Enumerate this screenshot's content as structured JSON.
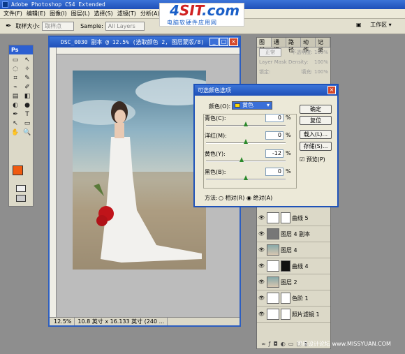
{
  "app": {
    "title": "Adobe Photoshop CS4 Extended"
  },
  "menu": [
    "文件(F)",
    "编辑(E)",
    "图像(I)",
    "图层(L)",
    "选择(S)",
    "滤镜(T)",
    "分析(A)",
    "视"
  ],
  "options": {
    "sample_size_label": "取样大小:",
    "sample_size_value": "取样点",
    "sample_label": "Sample:",
    "sample_value": "All Layers",
    "workspace": "工作区 ▾"
  },
  "logo": {
    "big_a": "4",
    "big_b": "SIT",
    "big_c": ".com",
    "small": "电脑软硬件应用网"
  },
  "toolbox": {
    "header": "Ps",
    "tools": [
      "▭",
      "↖",
      "◌",
      "✧",
      "⌗",
      "✎",
      "⌁",
      "✐",
      "▤",
      "◧",
      "◐",
      "●",
      "✒",
      "T",
      "↖",
      "▭",
      "✋",
      "🔍"
    ]
  },
  "document": {
    "title": "DSC_0030 副本 @ 12.5% (选取颜色 2, 图层蒙版/8)",
    "zoom": "12.5%",
    "size": "10.8 英寸 x 16.133 英寸 (240 ..."
  },
  "panel": {
    "tabs": [
      "图层",
      "通道",
      "路径",
      "动作",
      "记录"
    ],
    "blend_mode": "正常",
    "opacity_label": "不透明度:",
    "opacity_value": "100%",
    "density_label": "Layer Mask Density:",
    "density_value": "100%",
    "lock_label": "锁定:",
    "fill_label": "填充:",
    "fill_value": "100%",
    "layers": [
      {
        "name": "曲线 5",
        "thumb": "curve",
        "mask": "white"
      },
      {
        "name": "图层 4 副本",
        "thumb": "dark",
        "mask": ""
      },
      {
        "name": "图层 4",
        "thumb": "photo",
        "mask": ""
      },
      {
        "name": "曲线 4",
        "thumb": "curve",
        "mask": "black"
      },
      {
        "name": "图层 2",
        "thumb": "photo",
        "mask": ""
      },
      {
        "name": "色阶 1",
        "thumb": "curve",
        "mask": "white"
      },
      {
        "name": "照片滤镜 1",
        "thumb": "curve",
        "mask": "white"
      }
    ]
  },
  "dialog": {
    "title": "可选颜色选项",
    "color_label": "颜色(O):",
    "color_value": "黄色",
    "cyan_label": "青色(C):",
    "cyan_value": "0",
    "magenta_label": "洋红(M):",
    "magenta_value": "0",
    "yellow_label": "黄色(Y):",
    "yellow_value": "-12",
    "black_label": "黑色(B):",
    "black_value": "0",
    "pct": "%",
    "ok": "确定",
    "reset": "复位",
    "load": "载入(L)...",
    "save": "存储(S)...",
    "preview": "预览(P)",
    "method_label": "方法:",
    "relative": "相对(R)",
    "absolute": "绝对(A)"
  },
  "watermark": "思缘设计论坛 www.MISSYUAN.COM"
}
